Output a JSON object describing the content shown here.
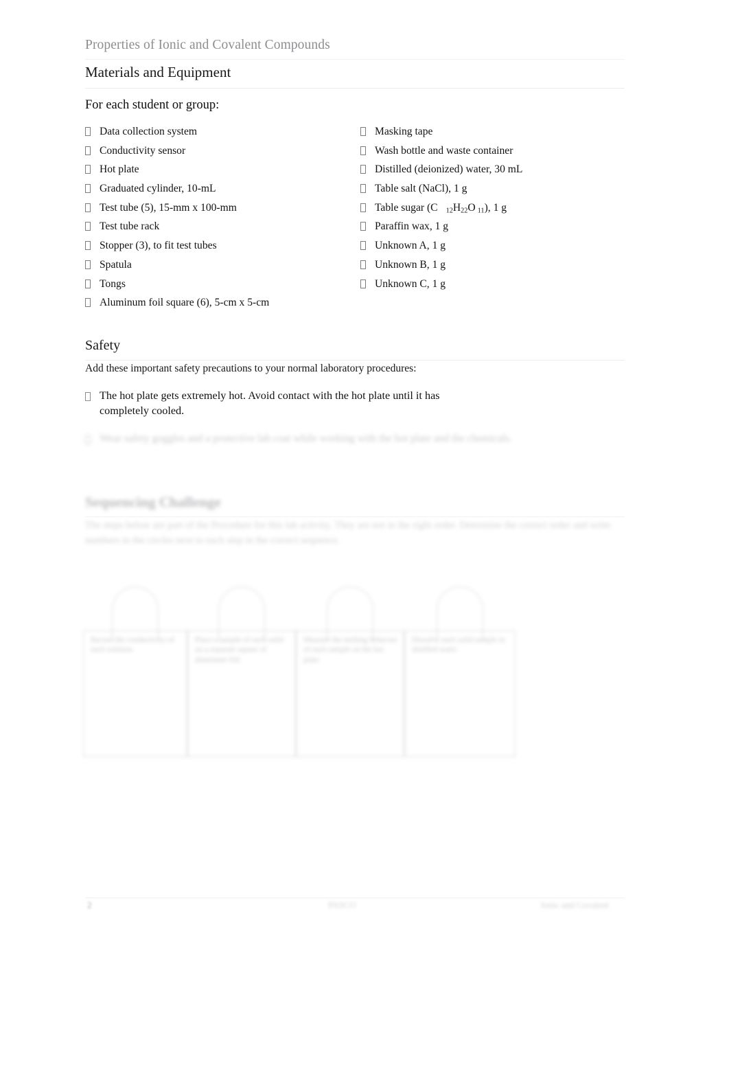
{
  "header": {
    "running_title": "Properties of Ionic and Covalent Compounds"
  },
  "materials": {
    "heading": "Materials and Equipment",
    "lead": "For each student or group:",
    "left_column": [
      "Data collection system",
      "Conductivity sensor",
      "Hot plate",
      "Graduated cylinder, 10-mL",
      "Test tube (5), 15-mm x 100-mm",
      "Test tube rack",
      "Stopper (3), to fit test tubes",
      "Spatula",
      "Tongs",
      "Aluminum foil square (6), 5-cm x 5-cm"
    ],
    "right_column": [
      "Masking tape",
      "Wash bottle and waste container",
      "Distilled (deionized) water, 30 mL",
      "Table salt (NaCl), 1 g",
      "Table sugar (C 12H22O 11), 1 g",
      "Paraffin wax, 1 g",
      "Unknown A, 1 g",
      "Unknown B, 1 g",
      "Unknown C, 1 g"
    ],
    "sugar": {
      "prefix": "Table sugar (C",
      "sub1": "12",
      "mid1": "H",
      "sub2": "22",
      "mid2": "O",
      "sub3": "11",
      "suffix": "), 1 g"
    }
  },
  "safety": {
    "heading": "Safety",
    "intro": "Add these important safety precautions to your normal laboratory procedures:",
    "items": [
      "The hot plate gets extremely hot. Avoid contact with the hot plate until it has completely cooled."
    ],
    "faded_item": "Wear safety goggles and a protective lab coat while working with the hot plate and the chemicals."
  },
  "sequencing": {
    "heading": "Sequencing Challenge",
    "paragraph": "The steps below are part of the Procedure for this lab activity. They are not in the right order. Determine the correct order and write numbers in the circles next to each step in the correct sequence."
  },
  "cards": [
    {
      "name": "card-a",
      "text": "Record the conductivity of each solution."
    },
    {
      "name": "card-b",
      "text": "Place a sample of each solid on a separate square of aluminum foil."
    },
    {
      "name": "card-c",
      "text": "Measure the melting behavior of each sample on the hot plate."
    },
    {
      "name": "card-d",
      "text": "Dissolve each solid sample in distilled water."
    }
  ],
  "footer": {
    "page_number": "2",
    "center": "PASCO",
    "right": "Ionic and Covalent"
  },
  "colors": {
    "header_gray": "#8d8d92",
    "body_black": "#121214",
    "rule_gray": "#ededee",
    "faded_gray": "#b8b8bc",
    "card_border": "#cbcbcf"
  }
}
